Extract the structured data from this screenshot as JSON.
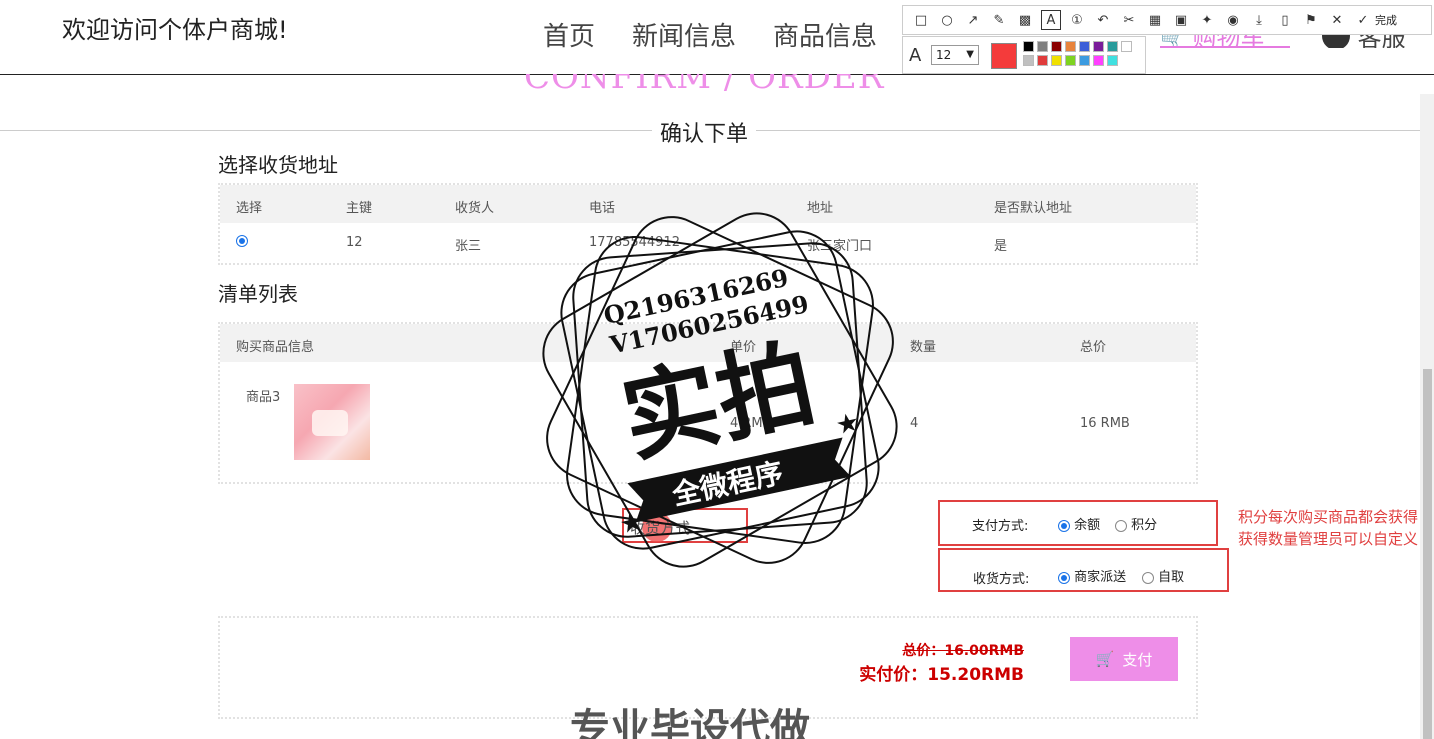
{
  "header": {
    "site_title": "欢迎访问个体户商城!",
    "nav": [
      "首页",
      "新闻信息",
      "商品信息"
    ],
    "cart_label": "购物车",
    "service_label": "客服"
  },
  "toolbar": {
    "done_label": "完成",
    "font_size": "12",
    "current_color": "#f43b3b",
    "palette": [
      "#000000",
      "#808080",
      "#8b0000",
      "#e8843c",
      "#3c5fd8",
      "#7a1c9a",
      "#2a9b9b",
      "#ffffff",
      "#c0c0c0",
      "#e03c3c",
      "#f0e000",
      "#7ed321",
      "#3c9be0",
      "#ff40ff",
      "#40e0e0"
    ]
  },
  "section": {
    "title_en": "CONFIRM / ORDER",
    "title_cn": "确认下单"
  },
  "address": {
    "heading": "选择收货地址",
    "columns": [
      "选择",
      "主键",
      "收货人",
      "电话",
      "地址",
      "是否默认地址"
    ],
    "rows": [
      {
        "id": "12",
        "name": "张三",
        "phone": "17785544912",
        "address": "张三家门口",
        "default": "是"
      }
    ]
  },
  "items": {
    "heading": "清单列表",
    "columns": [
      "购买商品信息",
      "单价",
      "数量",
      "总价"
    ],
    "rows": [
      {
        "name": "商品3",
        "price": "4 RMB",
        "qty": "4",
        "total": "16 RMB"
      }
    ]
  },
  "payment": {
    "label": "支付方式:",
    "options": [
      "余额",
      "积分"
    ],
    "selected": "余额"
  },
  "shipping": {
    "label": "收货方式:",
    "options": [
      "商家派送",
      "自取"
    ],
    "selected": "商家派送",
    "small_label": "收货方式"
  },
  "note": "积分每次购买商品都会获得，获得数量管理员可以自定义",
  "totals": {
    "original": "总价：16.00RMB",
    "actual": "实付价：15.20RMB",
    "pay_button": "支付"
  },
  "watermark": {
    "line1": "Q2196316269",
    "line2": "V17060256499",
    "main": "实拍",
    "banner": "全微程序"
  },
  "bottom_text": "专业毕设代做"
}
